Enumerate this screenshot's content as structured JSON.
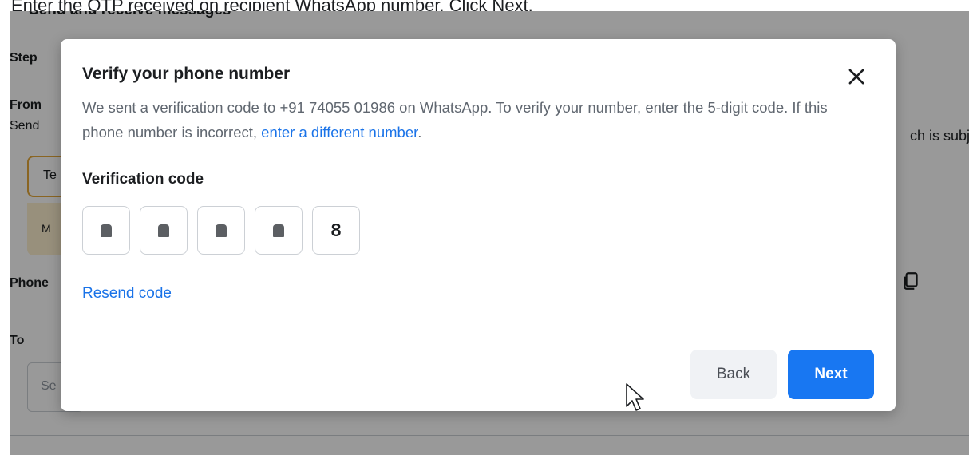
{
  "instruction": "Enter the OTP received on recipient WhatsApp number. Click Next.",
  "background": {
    "heading": "Send and receive messages",
    "step_label": "Step",
    "from_label": "From",
    "from_desc": "Send",
    "from_desc_tail": "ch is subj",
    "selected_value": "Te",
    "meta_value": "M",
    "phone_label": "Phone",
    "to_label": "To",
    "to_placeholder": "Se"
  },
  "modal": {
    "title": "Verify your phone number",
    "desc_part1": "We sent a verification code to +91 74055 01986 on WhatsApp. To verify your number, enter the 5-digit code. If this phone number is incorrect, ",
    "desc_link": "enter a different number",
    "desc_part2": ".",
    "code_label": "Verification code",
    "code_digits": [
      "•",
      "•",
      "•",
      "•",
      "8"
    ],
    "resend_label": "Resend code",
    "back_label": "Back",
    "next_label": "Next"
  },
  "icons": {
    "close": "close-icon",
    "copy": "copy-icon",
    "cursor": "mouse-pointer-icon"
  },
  "colors": {
    "accent": "#1877f2",
    "link": "#1a73e8"
  }
}
